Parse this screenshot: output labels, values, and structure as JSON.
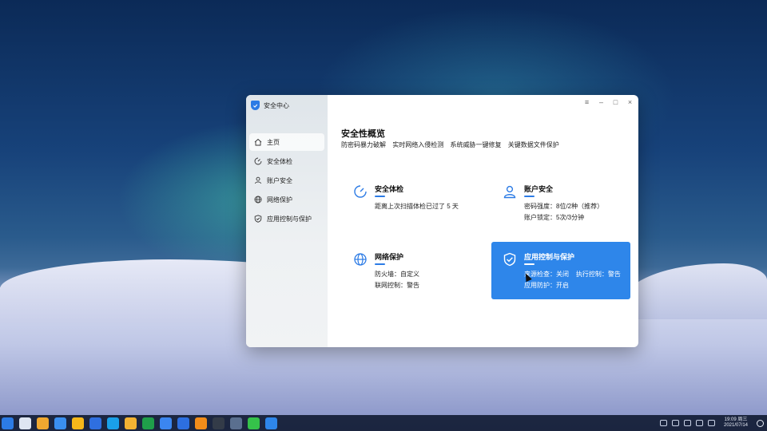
{
  "window": {
    "app_title": "安全中心",
    "controls": [
      "≡",
      "–",
      "□",
      "×"
    ]
  },
  "sidebar": {
    "items": [
      {
        "label": "主页",
        "icon": "home-icon",
        "active": true
      },
      {
        "label": "安全体检",
        "icon": "scan-icon",
        "active": false
      },
      {
        "label": "账户安全",
        "icon": "user-icon",
        "active": false
      },
      {
        "label": "网络保护",
        "icon": "globe-icon",
        "active": false
      },
      {
        "label": "应用控制与保护",
        "icon": "shield-check-icon",
        "active": false
      }
    ]
  },
  "main": {
    "title": "安全性概览",
    "subtitle_items": [
      "防密码暴力破解",
      "实时网络入侵检测",
      "系统威胁一键修复",
      "关键数据文件保护"
    ],
    "cards": {
      "scan": {
        "title": "安全体检",
        "line1": "距离上次扫描体检已过了 5 天",
        "icon": "scan-icon"
      },
      "account": {
        "title": "账户安全",
        "line1": "密码强度：8位/2种（推荐）",
        "line2": "账户锁定：5次/3分钟",
        "icon": "user-icon"
      },
      "network": {
        "title": "网络保护",
        "line1": "防火墙：自定义",
        "line2": "联网控制：警告",
        "icon": "globe-icon"
      },
      "app": {
        "title": "应用控制与保护",
        "line1": "来源检查：关闭    执行控制：警告",
        "line2": "应用防护：开启",
        "icon": "shield-check-icon"
      }
    }
  },
  "colors": {
    "accent": "#2e86ea",
    "sidebar_bg": "#e6ebee",
    "taskbar": "#0f1932"
  },
  "taskbar": {
    "apps": [
      {
        "name": "start-icon",
        "color": "#2c7be5"
      },
      {
        "name": "multitask-icon",
        "color": "#dfe6f2"
      },
      {
        "name": "file-manager-icon",
        "color": "#f0a830"
      },
      {
        "name": "security-center-icon",
        "color": "#3a8ff0"
      },
      {
        "name": "browser-icon",
        "color": "#f6b81a"
      },
      {
        "name": "wps-writer-icon",
        "color": "#2f6fe0"
      },
      {
        "name": "video-player-icon",
        "color": "#1aa0e8"
      },
      {
        "name": "files-icon",
        "color": "#f2b233"
      },
      {
        "name": "wps-sheet-icon",
        "color": "#1f9f4a"
      },
      {
        "name": "document-icon",
        "color": "#3b86f0"
      },
      {
        "name": "wps-icon",
        "color": "#2d6fe0"
      },
      {
        "name": "archive-icon",
        "color": "#f28c1a"
      },
      {
        "name": "terminal-icon",
        "color": "#333b48"
      },
      {
        "name": "system-monitor-icon",
        "color": "#5a6f8f"
      },
      {
        "name": "wechat-icon",
        "color": "#35c24a"
      },
      {
        "name": "security-center-active-icon",
        "color": "#2e86ea"
      }
    ],
    "clock_time": "19:09 周三",
    "clock_date": "2021/07/14"
  }
}
